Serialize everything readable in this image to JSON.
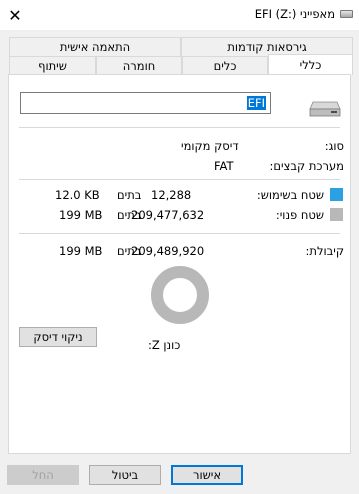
{
  "window": {
    "title": "מאפייני EFI (Z:)"
  },
  "tabs_back": [
    "גירסאות קודמות",
    "התאמה אישית"
  ],
  "tabs_front": [
    "כללי",
    "כלים",
    "חומרה",
    "שיתוף"
  ],
  "general": {
    "name_value": "EFI",
    "type_label": "סוג:",
    "type_value": "דיסק מקומי",
    "fs_label": "מערכת קבצים:",
    "fs_value": "FAT",
    "used_label": "שטח בשימוש:",
    "used_bytes": "12,288",
    "used_size": "12.0 KB",
    "free_label": "שטח פנוי:",
    "free_bytes": "209,477,632",
    "free_size": "199 MB",
    "capacity_label": "קיבולת:",
    "capacity_bytes": "209,489,920",
    "capacity_size": "199 MB",
    "bytes_word": "בתים",
    "drive_label": "כונן Z:",
    "cleanup_label": "ניקוי דיסק",
    "used_fraction": 0.0001
  },
  "colors": {
    "used": "#2d9fe3",
    "free": "#b8b8b8"
  },
  "buttons": {
    "ok": "אישור",
    "cancel": "ביטול",
    "apply": "החל"
  }
}
